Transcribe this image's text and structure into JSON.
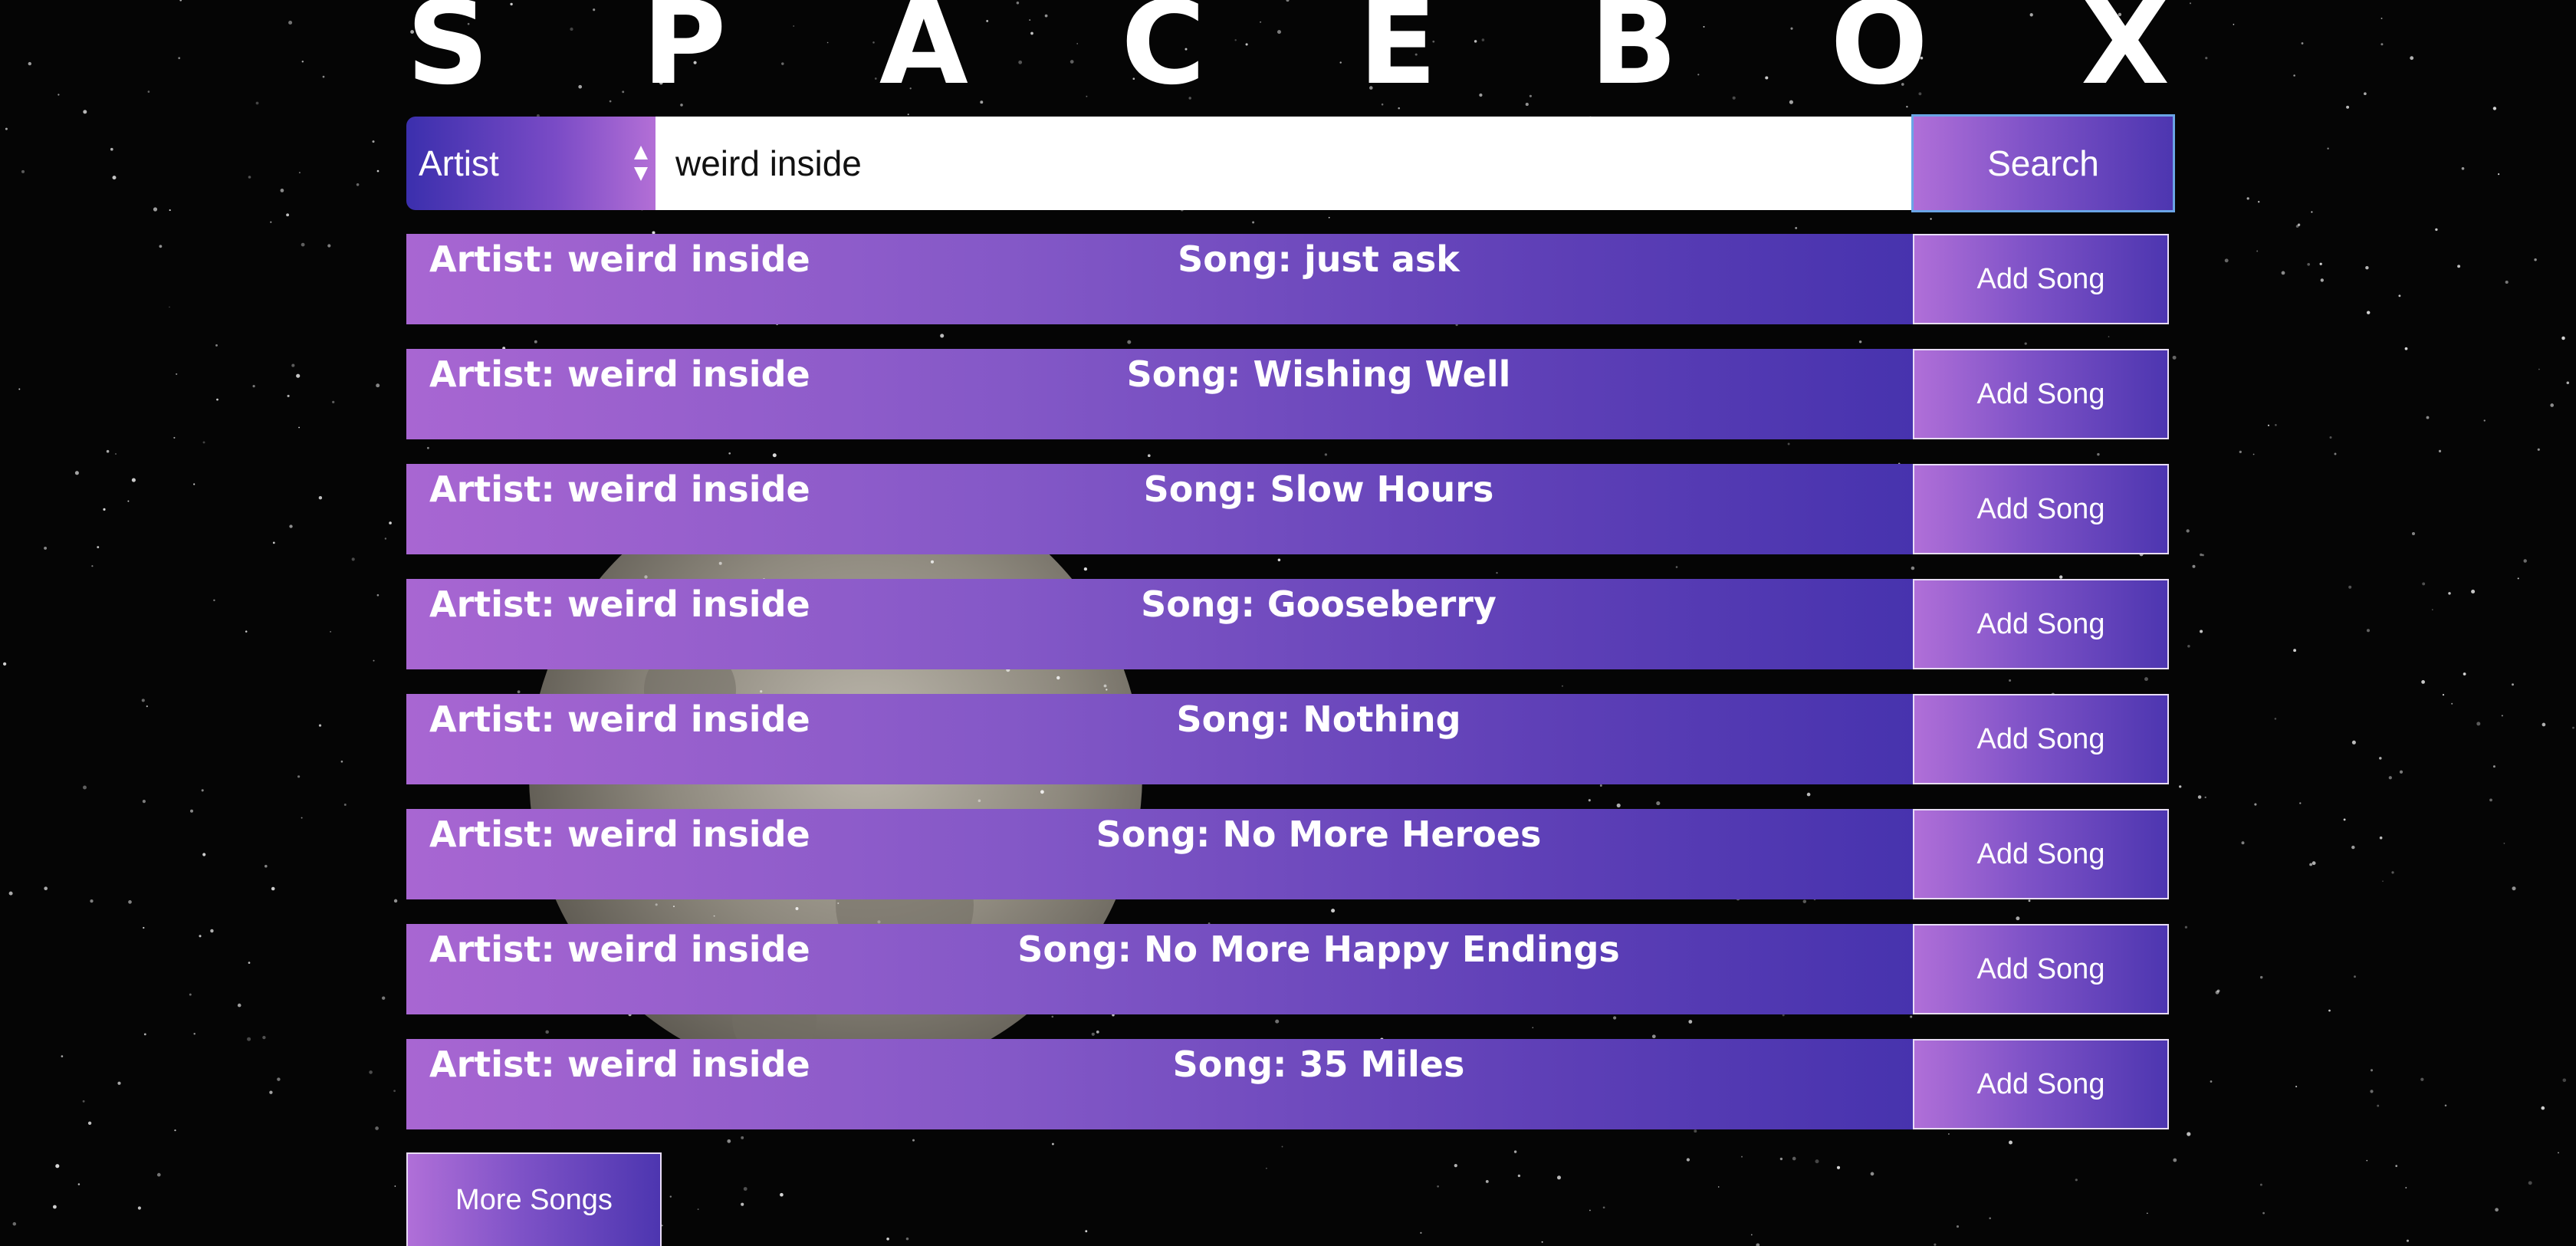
{
  "title": {
    "letters": [
      "S",
      "P",
      "A",
      "C",
      "E",
      "B",
      "O",
      "X"
    ]
  },
  "search": {
    "filter_selected": "Artist",
    "query_value": "weird inside",
    "button_label": "Search"
  },
  "results": [
    {
      "artist": "Artist: weird inside",
      "song": "Song: just ask",
      "button_label": "Add Song"
    },
    {
      "artist": "Artist: weird inside",
      "song": "Song: Wishing Well",
      "button_label": "Add Song"
    },
    {
      "artist": "Artist: weird inside",
      "song": "Song: Slow Hours",
      "button_label": "Add Song"
    },
    {
      "artist": "Artist: weird inside",
      "song": "Song: Gooseberry",
      "button_label": "Add Song"
    },
    {
      "artist": "Artist: weird inside",
      "song": "Song: Nothing",
      "button_label": "Add Song"
    },
    {
      "artist": "Artist: weird inside",
      "song": "Song: No More Heroes",
      "button_label": "Add Song"
    },
    {
      "artist": "Artist: weird inside",
      "song": "Song: No More Happy Endings",
      "button_label": "Add Song"
    },
    {
      "artist": "Artist: weird inside",
      "song": "Song: 35 Miles",
      "button_label": "Add Song"
    }
  ],
  "more_button_label": "More Songs",
  "colors": {
    "gradient_light": "#b06fd8",
    "gradient_dark": "#4733ae",
    "background": "#050505",
    "focus_border": "#6aa5e6"
  },
  "icons": {
    "select_arrows": "select-arrows-icon",
    "background": "moon-image"
  }
}
